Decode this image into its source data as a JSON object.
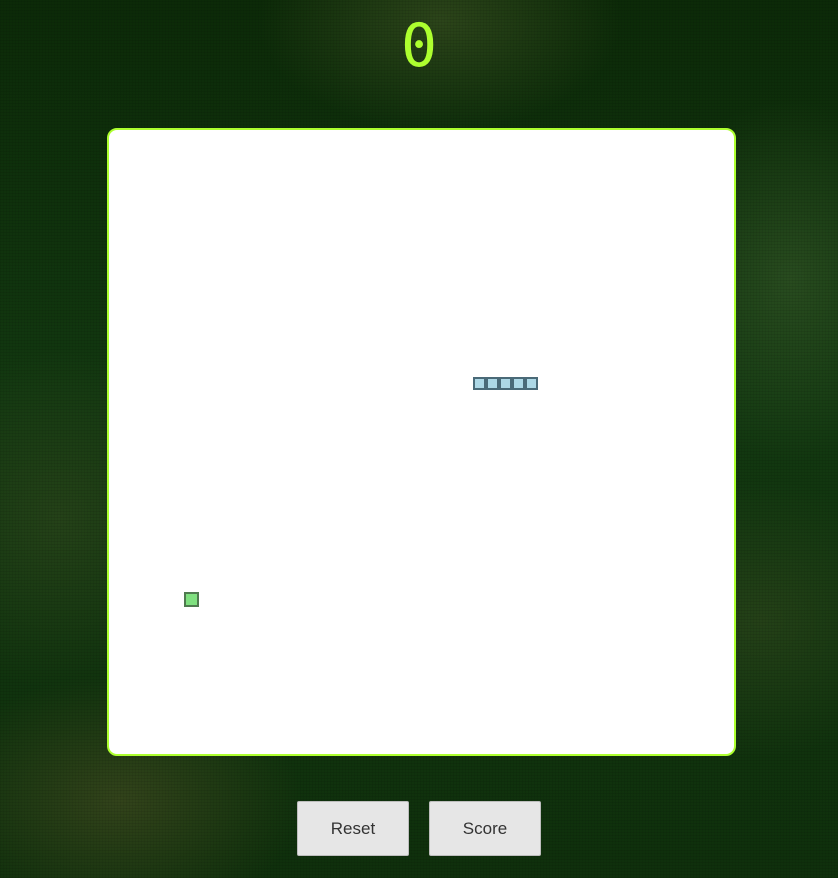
{
  "score": "0",
  "board": {
    "grid_cols": 48,
    "snake_segments": [
      [
        28,
        19
      ],
      [
        29,
        19
      ],
      [
        30,
        19
      ],
      [
        31,
        19
      ],
      [
        32,
        19
      ]
    ],
    "food": [
      5,
      36
    ]
  },
  "controls": {
    "reset_label": "Reset",
    "score_label": "Score"
  },
  "colors": {
    "accent": "#adff2f",
    "snake_fill": "#add8e6",
    "snake_border": "#4a6a78",
    "food_fill": "#7fe07f",
    "food_border": "#4f7a4f",
    "board_bg": "#ffffff"
  }
}
